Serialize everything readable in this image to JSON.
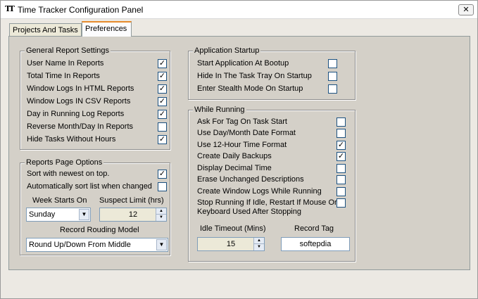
{
  "window": {
    "title": "Time Tracker Configuration Panel",
    "app_icon": "TT",
    "close_glyph": "✕"
  },
  "tabs": [
    {
      "label": "Projects And Tasks"
    },
    {
      "label": "Preferences"
    }
  ],
  "general_report": {
    "title": "General Report Settings",
    "items": [
      {
        "label": "User Name In Reports",
        "checked": true
      },
      {
        "label": "Total Time In Reports",
        "checked": true
      },
      {
        "label": "Window Logs In HTML Reports",
        "checked": true
      },
      {
        "label": "Window Logs IN CSV Reports",
        "checked": true
      },
      {
        "label": "Day in Running Log Reports",
        "checked": true
      },
      {
        "label": "Reverse Month/Day In Reports",
        "checked": false
      },
      {
        "label": "Hide Tasks Without Hours",
        "checked": true
      }
    ]
  },
  "reports_page": {
    "title": "Reports Page Options",
    "items": [
      {
        "label": "Sort with newest on top.",
        "checked": true
      },
      {
        "label": "Automatically sort list when changed",
        "checked": false
      }
    ],
    "week_starts_label": "Week Starts On",
    "week_starts_value": "Sunday",
    "suspect_limit_label": "Suspect Limit (hrs)",
    "suspect_limit_value": "12",
    "rounding_label": "Record Rouding Model",
    "rounding_value": "Round Up/Down From Middle"
  },
  "app_startup": {
    "title": "Application Startup",
    "items": [
      {
        "label": "Start Application At Bootup",
        "checked": false
      },
      {
        "label": "Hide In The Task Tray On Startup",
        "checked": false
      },
      {
        "label": "Enter Stealth Mode On Startup",
        "checked": false
      }
    ]
  },
  "while_running": {
    "title": "While Running",
    "items": [
      {
        "label": "Ask For Tag On Task Start",
        "checked": false
      },
      {
        "label": "Use Day/Month Date Format",
        "checked": false
      },
      {
        "label": "Use 12-Hour Time Format",
        "checked": true
      },
      {
        "label": "Create Daily Backups",
        "checked": true
      },
      {
        "label": "Display Decimal Time",
        "checked": false
      },
      {
        "label": "Erase Unchanged Descriptions",
        "checked": false
      },
      {
        "label": "Create Window Logs While Running",
        "checked": false
      }
    ],
    "stop_running_line1": "Stop Running If Idle, Restart If Mouse Or",
    "stop_running_line2": "Keyboard Used After Stopping",
    "stop_running_checked": false,
    "idle_timeout_label": "Idle Timeout (Mins)",
    "idle_timeout_value": "15",
    "record_tag_label": "Record Tag",
    "record_tag_value": "softepdia"
  },
  "glyphs": {
    "check": "✓",
    "arrow_down": "▼",
    "arrow_up": "▲"
  }
}
